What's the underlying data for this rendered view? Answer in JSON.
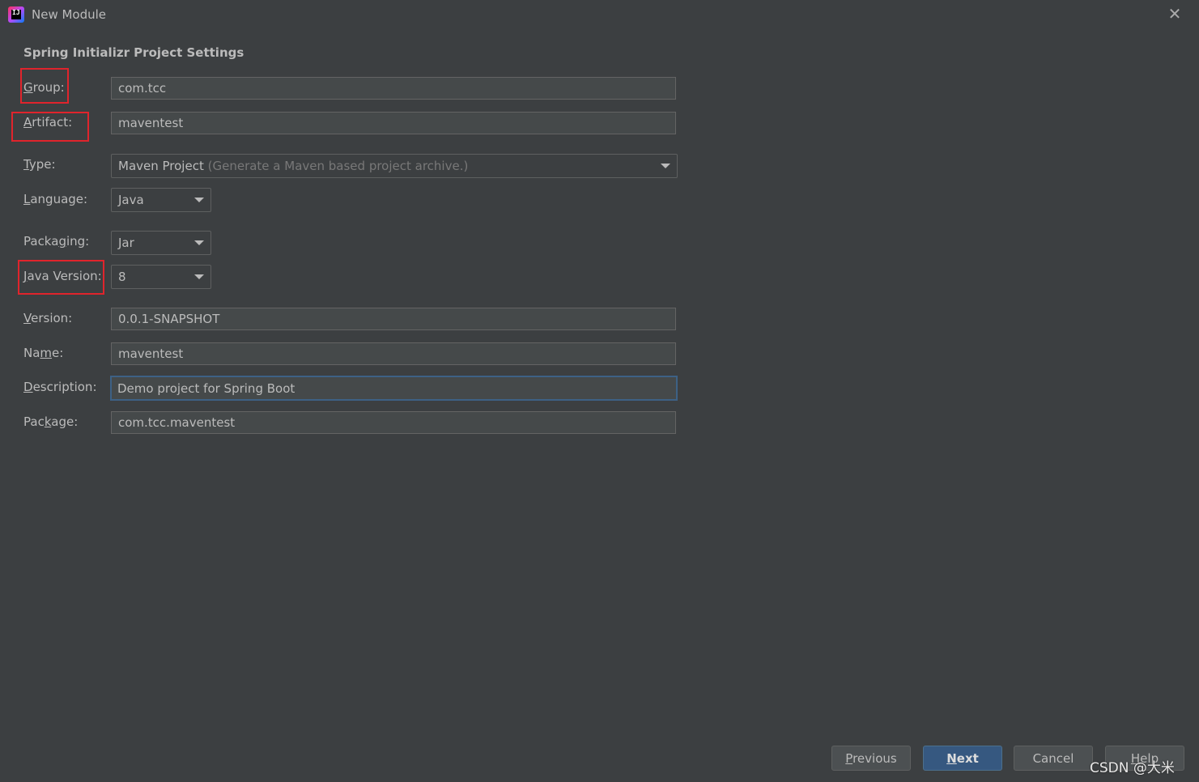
{
  "window": {
    "title": "New Module"
  },
  "section_title": "Spring Initializr Project Settings",
  "fields": {
    "group": {
      "label": "Group:",
      "mnemonic": "G",
      "rest": "roup:",
      "value": "com.tcc"
    },
    "artifact": {
      "label": "Artifact:",
      "mnemonic": "A",
      "rest": "rtifact:",
      "value": "maventest"
    },
    "type": {
      "label": "Type:",
      "mnemonic": "T",
      "rest": "ype:",
      "value": "Maven Project",
      "hint": "(Generate a Maven based project archive.)"
    },
    "language": {
      "label": "Language:",
      "pre": "",
      "mnemonic": "L",
      "rest": "anguage:",
      "value": "Java"
    },
    "packaging": {
      "label": "Packaging:",
      "pre": "Packa",
      "mnemonic": "g",
      "rest": "ing:",
      "value": "Jar"
    },
    "java_version": {
      "label": "Java Version:",
      "mnemonic": "J",
      "rest": "ava Version:",
      "value": "8"
    },
    "version": {
      "label": "Version:",
      "mnemonic": "V",
      "rest": "ersion:",
      "value": "0.0.1-SNAPSHOT"
    },
    "name": {
      "label": "Name:",
      "pre": "Na",
      "mnemonic": "m",
      "rest": "e:",
      "value": "maventest"
    },
    "description": {
      "label": "Description:",
      "mnemonic": "D",
      "rest": "escription:",
      "value": "Demo project for Spring Boot"
    },
    "package": {
      "label": "Package:",
      "pre": "Pac",
      "mnemonic": "k",
      "rest": "age:",
      "value": "com.tcc.maventest"
    }
  },
  "buttons": {
    "previous": {
      "mnemonic": "P",
      "rest": "revious"
    },
    "next": {
      "mnemonic": "N",
      "rest": "ext"
    },
    "cancel": "Cancel",
    "help": {
      "mnemonic": "H",
      "rest": "elp"
    }
  },
  "watermark": "CSDN @大米",
  "colors": {
    "background": "#3c3f41",
    "highlight": "#e0242c",
    "primary_button": "#365880",
    "focus_border": "#3d6185"
  }
}
